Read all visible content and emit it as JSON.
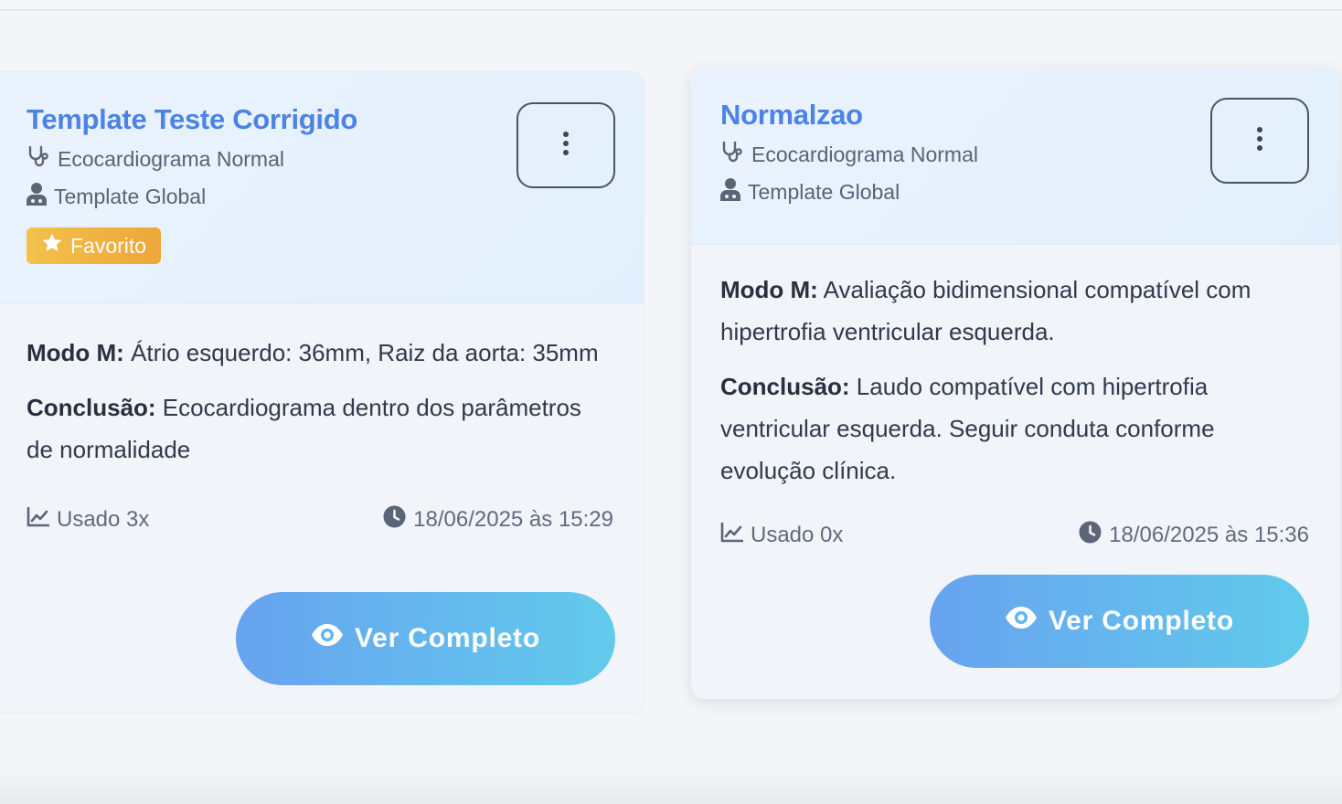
{
  "cards": [
    {
      "title": "Template Teste Corrigido",
      "exam_type": "Ecocardiograma Normal",
      "scope": "Template Global",
      "badge": "Favorito",
      "sections": [
        {
          "label": "Modo M:",
          "text": " Átrio esquerdo: 36mm, Raiz da aorta: 35mm"
        },
        {
          "label": "Conclusão:",
          "text": " Ecocardiograma dentro dos parâmetros de normalidade"
        }
      ],
      "usage": "Usado 3x",
      "date": "18/06/2025 às 15:29",
      "view_label": "Ver Completo"
    },
    {
      "title": "Normalzao",
      "exam_type": "Ecocardiograma Normal",
      "scope": "Template Global",
      "sections": [
        {
          "label": "Modo M:",
          "text": " Avaliação bidimensional compatível com hipertrofia ventricular esquerda."
        },
        {
          "label": "Conclusão:",
          "text": " Laudo compatível com hipertrofia ventricular esquerda. Seguir conduta conforme evolução clínica."
        }
      ],
      "usage": "Usado 0x",
      "date": "18/06/2025 às 15:36",
      "view_label": "Ver Completo"
    }
  ],
  "colors": {
    "title": "#4b83e6",
    "badge": "#eea63a",
    "button_start": "#67a3ef",
    "button_end": "#62cbec"
  },
  "icons": {
    "exam": "stethoscope-icon",
    "scope": "user-doctor-icon",
    "badge": "star-icon",
    "menu": "vertical-ellipsis-icon",
    "usage": "line-chart-icon",
    "date": "clock-icon",
    "view": "eye-icon"
  }
}
